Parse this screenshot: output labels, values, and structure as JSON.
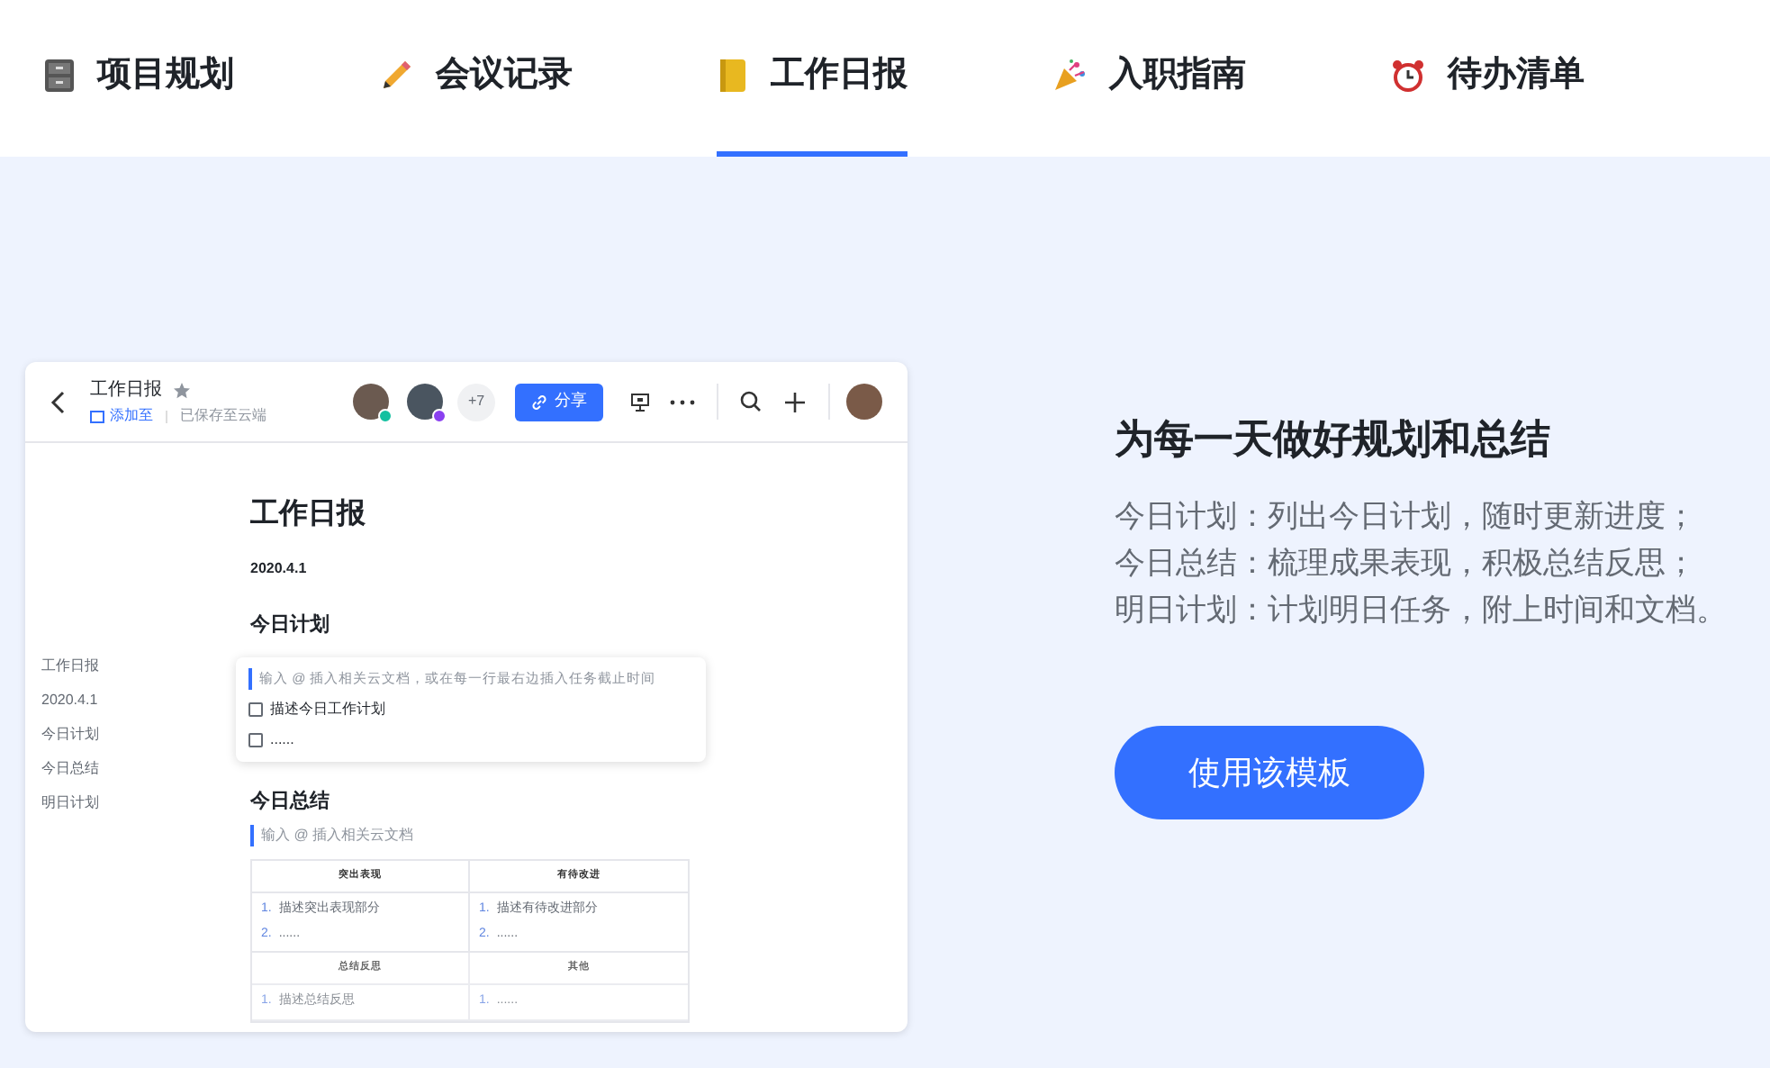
{
  "tabs": [
    {
      "label": "项目规划",
      "selected": false
    },
    {
      "label": "会议记录",
      "selected": false
    },
    {
      "label": "工作日报",
      "selected": true
    },
    {
      "label": "入职指南",
      "selected": false
    },
    {
      "label": "待办清单",
      "selected": false
    }
  ],
  "preview": {
    "doc_title": "工作日报",
    "add_to": "添加至",
    "save_status": "已保存至云端",
    "more_count": "+7",
    "share_button": "分享",
    "outline": [
      "工作日报",
      "2020.4.1",
      "今日计划",
      "今日总结",
      "明日计划"
    ],
    "heading": "工作日报",
    "date": "2020.4.1",
    "plan_heading": "今日计划",
    "plan_hint": "输入 @ 插入相关云文档，或在每一行最右边插入任务截止时间",
    "tasks": [
      {
        "text": "描述今日工作计划",
        "checked": false
      },
      {
        "text": "......",
        "checked": false
      }
    ],
    "summary_heading": "今日总结",
    "summary_hint": "输入 @ 插入相关云文档",
    "table": [
      {
        "headers": [
          "突出表现",
          "有待改进"
        ],
        "cells": [
          [
            [
              "1.",
              "描述突出表现部分"
            ],
            [
              "2.",
              "......"
            ]
          ],
          [
            [
              "1.",
              "描述有待改进部分"
            ],
            [
              "2.",
              "......"
            ]
          ]
        ]
      },
      {
        "headers": [
          "总结反思",
          "其他"
        ],
        "cells": [
          [
            [
              "1.",
              "描述总结反思"
            ]
          ],
          [
            [
              "1.",
              "......"
            ]
          ]
        ]
      }
    ]
  },
  "feature": {
    "title": "为每一天做好规划和总结",
    "lines": [
      "今日计划：列出今日计划，随时更新进度；",
      "今日总结：梳理成果表现，积极总结反思；",
      "明日计划：计划明日任务，附上时间和文档。"
    ],
    "button": "使用该模板"
  }
}
